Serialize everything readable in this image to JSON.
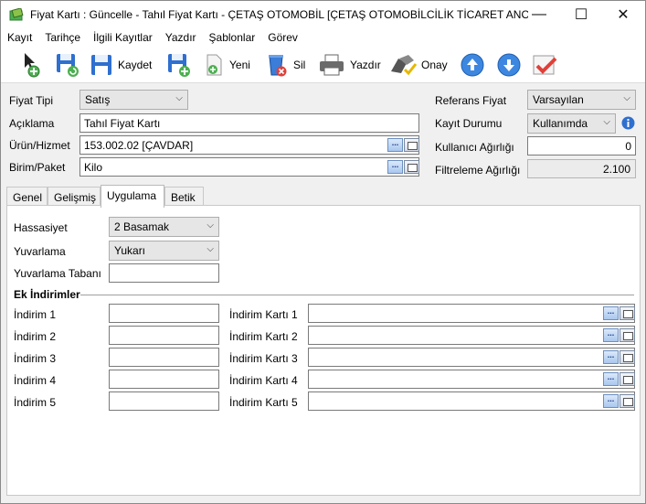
{
  "window": {
    "title": "Fiyat Kartı : Güncelle - Tahıl Fiyat Kartı - ÇETAŞ OTOMOBİL [ÇETAŞ OTOMOBİLCİLİK TİCARET ANONİ...",
    "minimize": "—",
    "maximize": "☐",
    "close": "✕"
  },
  "menu": [
    "Kayıt",
    "Tarihçe",
    "İlgili Kayıtlar",
    "Yazdır",
    "Şablonlar",
    "Görev"
  ],
  "toolbar": {
    "save_label": "Kaydet",
    "new_label": "Yeni",
    "delete_label": "Sil",
    "print_label": "Yazdır",
    "approve_label": "Onay"
  },
  "form": {
    "fiyat_tipi_label": "Fiyat Tipi",
    "fiyat_tipi_value": "Satış",
    "aciklama_label": "Açıklama",
    "aciklama_value": "Tahıl Fiyat Kartı",
    "urun_label": "Ürün/Hizmet",
    "urun_value": "153.002.02 [ÇAVDAR]",
    "birim_label": "Birim/Paket",
    "birim_value": "Kilo",
    "referans_label": "Referans Fiyat",
    "referans_value": "Varsayılan",
    "kayit_durumu_label": "Kayıt Durumu",
    "kayit_durumu_value": "Kullanımda",
    "kullanici_agirligi_label": "Kullanıcı Ağırlığı",
    "kullanici_agirligi_value": "0",
    "filtreleme_agirligi_label": "Filtreleme Ağırlığı",
    "filtreleme_agirligi_value": "2.100",
    "ellipsis": "..."
  },
  "tabs": [
    "Genel",
    "Gelişmiş",
    "Uygulama",
    "Betik"
  ],
  "active_tab": "Uygulama",
  "uygulama": {
    "hassasiyet_label": "Hassasiyet",
    "hassasiyet_value": "2 Basamak",
    "yuvarlama_label": "Yuvarlama",
    "yuvarlama_value": "Yukarı",
    "yuvarlama_tabani_label": "Yuvarlama Tabanı",
    "yuvarlama_tabani_value": "",
    "ek_indirimler_label": "Ek İndirimler",
    "discounts": [
      {
        "label": "İndirim 1",
        "card_label": "İndirim Kartı 1",
        "value": "",
        "card_value": ""
      },
      {
        "label": "İndirim 2",
        "card_label": "İndirim Kartı 2",
        "value": "",
        "card_value": ""
      },
      {
        "label": "İndirim 3",
        "card_label": "İndirim Kartı 3",
        "value": "",
        "card_value": ""
      },
      {
        "label": "İndirim 4",
        "card_label": "İndirim Kartı 4",
        "value": "",
        "card_value": ""
      },
      {
        "label": "İndirim 5",
        "card_label": "İndirim Kartı 5",
        "value": "",
        "card_value": ""
      }
    ]
  },
  "colors": {
    "accent_blue": "#2f6fcf",
    "approve_red": "#e0403a"
  },
  "icons": [
    "app-icon",
    "new-icon",
    "save-refresh-icon",
    "save-icon",
    "save-new-icon",
    "new-doc-icon",
    "delete-icon",
    "printer-icon",
    "approve-icon",
    "arrow-up-icon",
    "arrow-down-icon",
    "checklist-icon",
    "info-icon"
  ]
}
